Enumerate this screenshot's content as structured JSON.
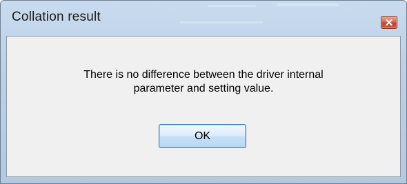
{
  "window": {
    "title": "Collation result",
    "accent_color": "#c7402a",
    "frame_color": "#bcd1e8"
  },
  "title_bar": {
    "close_icon": "close-icon"
  },
  "message": {
    "line1": "There is no difference between the driver internal",
    "line2": "parameter and setting value."
  },
  "buttons": {
    "ok_label": "OK"
  }
}
